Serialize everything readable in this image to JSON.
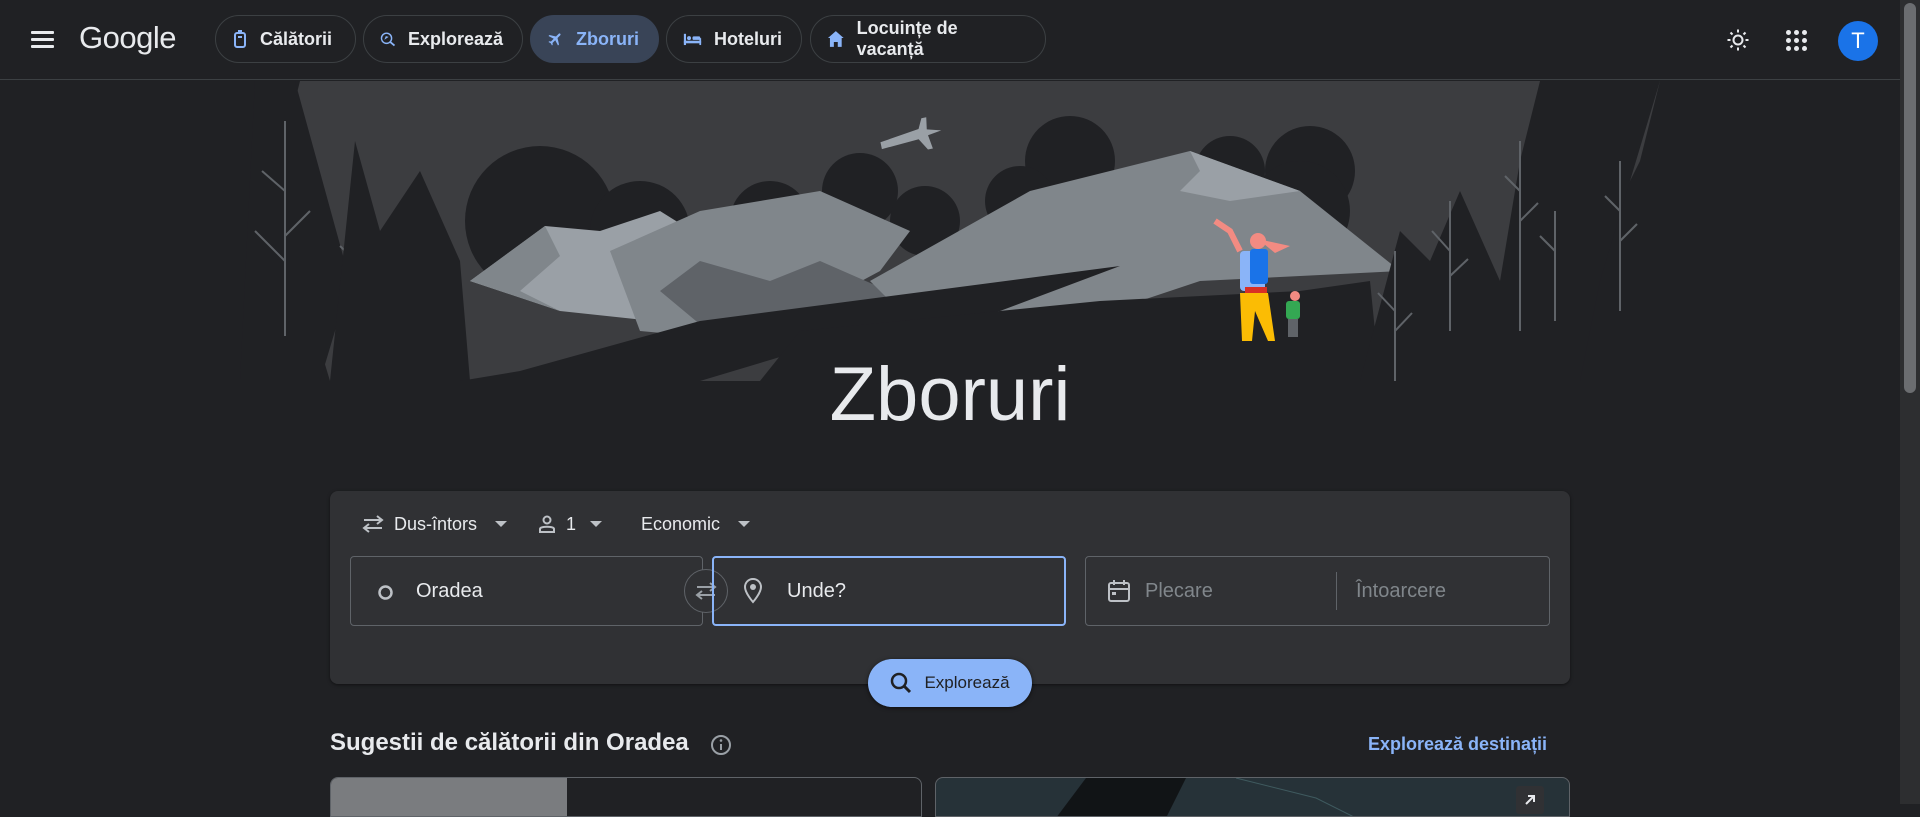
{
  "header": {
    "logo": "Google",
    "nav": [
      {
        "label": "Călătorii",
        "icon": "luggage-icon"
      },
      {
        "label": "Explorează",
        "icon": "explore-search-icon"
      },
      {
        "label": "Zboruri",
        "icon": "airplane-icon",
        "active": true
      },
      {
        "label": "Hoteluri",
        "icon": "bed-icon"
      },
      {
        "label": "Locuințe de vacanță",
        "icon": "house-icon"
      }
    ],
    "theme_icon": "brightness-icon",
    "apps_icon": "apps-grid-icon",
    "avatar_letter": "T"
  },
  "hero": {
    "title": "Zboruri"
  },
  "search": {
    "trip_type": "Dus-întors",
    "passengers": "1",
    "cabin_class": "Economic",
    "origin": "Oradea",
    "destination": "Unde?",
    "departure_placeholder": "Plecare",
    "return_placeholder": "Întoarcere",
    "explore_button": "Explorează"
  },
  "suggestions": {
    "title": "Sugestii de călătorii din Oradea",
    "explore_link": "Explorează destinații"
  },
  "colors": {
    "background": "#202124",
    "card": "#303134",
    "accent": "#8ab4f8",
    "active_chip": "#394457",
    "avatar": "#1a73e8"
  }
}
